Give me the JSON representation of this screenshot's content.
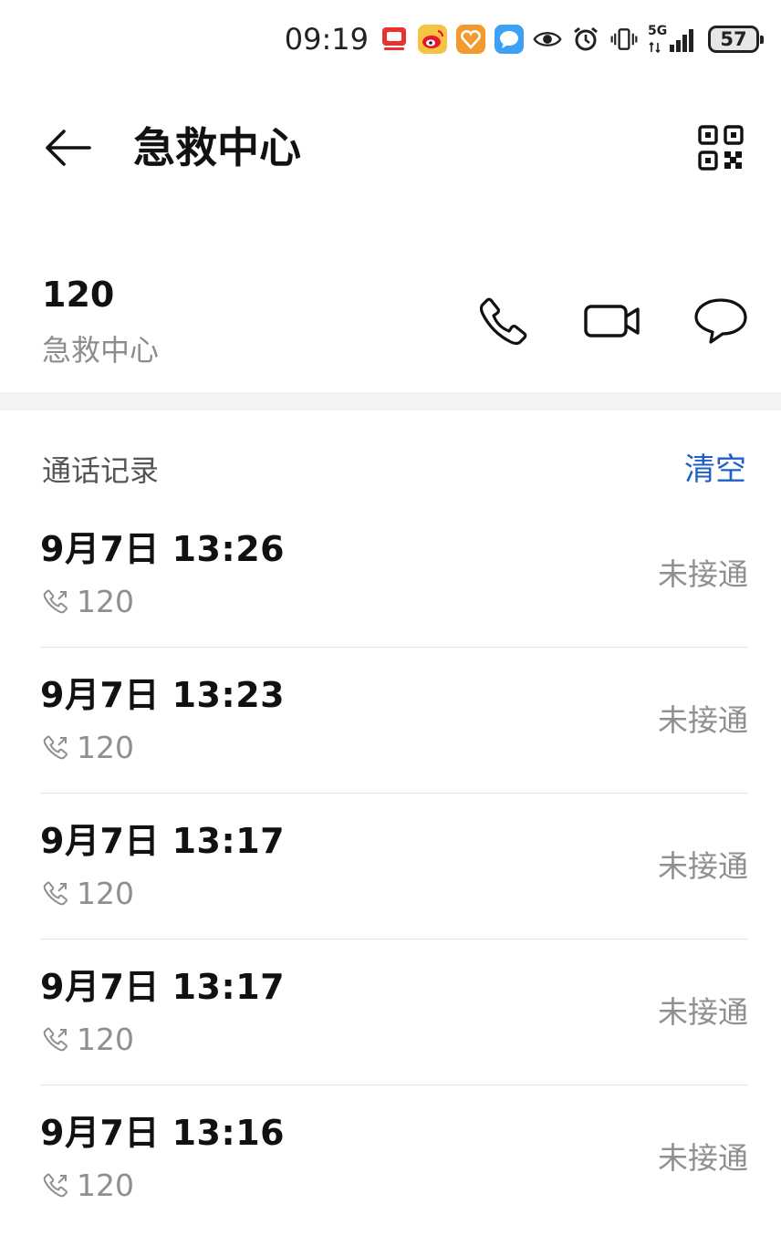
{
  "status_bar": {
    "time": "09:19",
    "network": "5G",
    "battery": "57"
  },
  "header": {
    "title": "急救中心"
  },
  "contact": {
    "number": "120",
    "name": "急救中心"
  },
  "call_log": {
    "title": "通话记录",
    "clear_label": "清空",
    "entries": [
      {
        "datetime": "9月7日 13:26",
        "number": "120",
        "status": "未接通"
      },
      {
        "datetime": "9月7日 13:23",
        "number": "120",
        "status": "未接通"
      },
      {
        "datetime": "9月7日 13:17",
        "number": "120",
        "status": "未接通"
      },
      {
        "datetime": "9月7日 13:17",
        "number": "120",
        "status": "未接通"
      },
      {
        "datetime": "9月7日 13:16",
        "number": "120",
        "status": "未接通"
      }
    ]
  },
  "colors": {
    "accent": "#1f5fc8",
    "secondary_text": "#8f8f8f",
    "divider": "#e2e2e2"
  }
}
